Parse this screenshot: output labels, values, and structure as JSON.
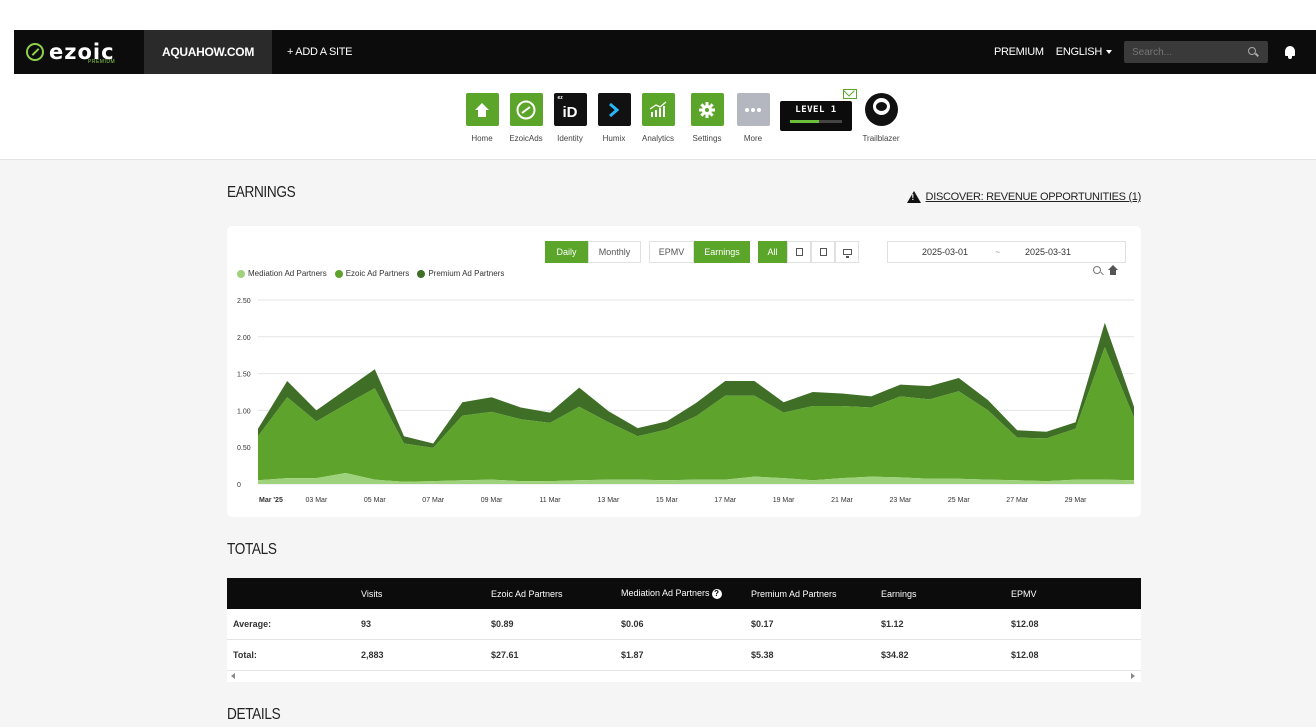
{
  "topbar": {
    "logo": "ezoic",
    "logo_sub": "PREMIUM",
    "site": "AQUAHOW.COM",
    "add_site": "+ ADD A SITE",
    "premium": "PREMIUM",
    "language": "ENGLISH",
    "search_placeholder": "Search..."
  },
  "apps": [
    {
      "label": "Home",
      "icon": "home-icon"
    },
    {
      "label": "EzoicAds",
      "icon": "ezoic-logo-icon"
    },
    {
      "label": "Identity",
      "icon": "identity-icon",
      "glyph": "iD",
      "badge": "ez"
    },
    {
      "label": "Humix",
      "icon": "humix-chevron-icon"
    },
    {
      "label": "Analytics",
      "icon": "analytics-chart-icon"
    },
    {
      "label": "Settings",
      "icon": "gear-icon"
    },
    {
      "label": "More",
      "icon": "more-dots-icon"
    }
  ],
  "level": {
    "label": "LEVEL 1",
    "progress": 0.55
  },
  "trailblazer": {
    "label": "Trailblazer"
  },
  "earnings": {
    "title": "EARNINGS",
    "discover": "DISCOVER: REVENUE OPPORTUNITIES (1)"
  },
  "toolbar": {
    "daily": "Daily",
    "monthly": "Monthly",
    "epmv": "EPMV",
    "earnings": "Earnings",
    "all": "All",
    "date_start": "2025-03-01",
    "date_sep": "~",
    "date_end": "2025-03-31"
  },
  "colors": {
    "accent": "#5ba52a",
    "mediation": "#9fd27c",
    "ezoic": "#5ea32c",
    "premium": "#3f6f26"
  },
  "chart_data": {
    "type": "area",
    "stacked": true,
    "legend_position": "top-left",
    "grid": true,
    "ylim": [
      0,
      2.5
    ],
    "yticks": [
      "0",
      "0.50",
      "1.00",
      "1.50",
      "2.00",
      "2.50"
    ],
    "xtick_labels": [
      "Mar '25",
      "03 Mar",
      "05 Mar",
      "07 Mar",
      "09 Mar",
      "11 Mar",
      "13 Mar",
      "15 Mar",
      "17 Mar",
      "19 Mar",
      "21 Mar",
      "23 Mar",
      "25 Mar",
      "27 Mar",
      "29 Mar"
    ],
    "x": [
      "2025-03-01",
      "2025-03-02",
      "2025-03-03",
      "2025-03-04",
      "2025-03-05",
      "2025-03-06",
      "2025-03-07",
      "2025-03-08",
      "2025-03-09",
      "2025-03-10",
      "2025-03-11",
      "2025-03-12",
      "2025-03-13",
      "2025-03-14",
      "2025-03-15",
      "2025-03-16",
      "2025-03-17",
      "2025-03-18",
      "2025-03-19",
      "2025-03-20",
      "2025-03-21",
      "2025-03-22",
      "2025-03-23",
      "2025-03-24",
      "2025-03-25",
      "2025-03-26",
      "2025-03-27",
      "2025-03-28",
      "2025-03-29",
      "2025-03-30",
      "2025-03-31"
    ],
    "series": [
      {
        "name": "Mediation Ad Partners",
        "values": [
          0.05,
          0.08,
          0.08,
          0.15,
          0.06,
          0.03,
          0.04,
          0.05,
          0.06,
          0.04,
          0.04,
          0.05,
          0.06,
          0.06,
          0.05,
          0.06,
          0.06,
          0.1,
          0.08,
          0.05,
          0.08,
          0.1,
          0.09,
          0.07,
          0.07,
          0.06,
          0.05,
          0.04,
          0.06,
          0.06,
          0.05
        ]
      },
      {
        "name": "Ezoic Ad Partners",
        "values": [
          0.6,
          1.1,
          0.77,
          0.93,
          1.24,
          0.52,
          0.45,
          0.88,
          0.92,
          0.84,
          0.79,
          1.0,
          0.78,
          0.59,
          0.69,
          0.86,
          1.14,
          1.1,
          0.89,
          1.01,
          0.98,
          0.94,
          1.1,
          1.08,
          1.19,
          0.94,
          0.58,
          0.58,
          0.69,
          1.8,
          0.85
        ]
      },
      {
        "name": "Premium Ad Partners",
        "values": [
          0.1,
          0.22,
          0.15,
          0.2,
          0.26,
          0.1,
          0.06,
          0.18,
          0.2,
          0.16,
          0.14,
          0.26,
          0.15,
          0.11,
          0.11,
          0.18,
          0.2,
          0.2,
          0.14,
          0.19,
          0.17,
          0.15,
          0.16,
          0.18,
          0.18,
          0.14,
          0.1,
          0.09,
          0.09,
          0.33,
          0.15
        ]
      }
    ]
  },
  "totals": {
    "title": "TOTALS",
    "headers": [
      "",
      "Visits",
      "Ezoic Ad Partners",
      "Mediation Ad Partners",
      "Premium Ad Partners",
      "Earnings",
      "EPMV"
    ],
    "rows": [
      [
        "Average:",
        "93",
        "$0.89",
        "$0.06",
        "$0.17",
        "$1.12",
        "$12.08"
      ],
      [
        "Total:",
        "2,883",
        "$27.61",
        "$1.87",
        "$5.38",
        "$34.82",
        "$12.08"
      ]
    ]
  },
  "details": {
    "title": "DETAILS"
  }
}
